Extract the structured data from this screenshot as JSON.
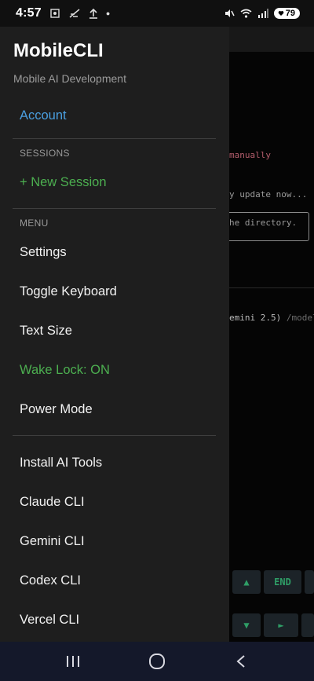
{
  "status_bar": {
    "time": "4:57",
    "battery": "79"
  },
  "drawer": {
    "title": "MobileCLI",
    "subtitle": "Mobile AI Development",
    "account_label": "Account",
    "sessions_header": "SESSIONS",
    "new_session_label": "+ New Session",
    "menu_header": "MENU",
    "menu_items": [
      "Settings",
      "Toggle Keyboard",
      "Text Size",
      "Wake Lock: ON",
      "Power Mode"
    ],
    "tool_items": [
      "Install AI Tools",
      "Claude CLI",
      "Gemini CLI",
      "Codex CLI",
      "Vercel CLI"
    ]
  },
  "terminal": {
    "line_manually": "manually",
    "line_update": "y update now...",
    "line_directory": "he directory.",
    "model_prefix": "emini 2.5)",
    "model_suffix": "/model",
    "keys_row1": [
      "▲",
      "END"
    ],
    "keys_row2": [
      "▼",
      "►"
    ]
  },
  "colors": {
    "accent_blue": "#4a9fe0",
    "accent_green": "#4caf50",
    "drawer_bg": "#1e1e1e"
  }
}
